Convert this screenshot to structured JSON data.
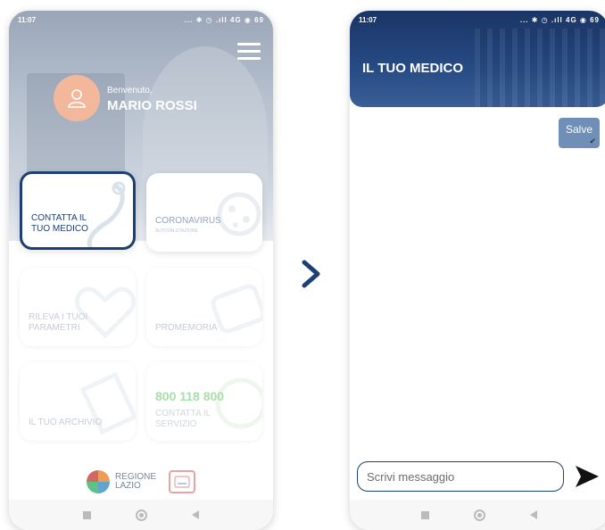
{
  "screen1": {
    "status": {
      "time": "11:07",
      "icons": "... ✱ ◷ .ıll 4G ◉ 69"
    },
    "welcome": "Benvenuto,",
    "username": "MARIO ROSSI",
    "tiles": {
      "contact_doctor": "CONTATTA IL\nTUO MEDICO",
      "coronavirus": "CORONAVIRUS",
      "coronavirus_sub": "AUTOVALUTAZIONE",
      "parameters": "RILEVA I TUOI\nPARAMETRI",
      "reminders": "PROMEMORIA",
      "archive": "IL TUO ARCHIVIO",
      "phone_number": "800 118 800",
      "contact_service": "CONTATTA IL\nSERVIZIO"
    },
    "logos": {
      "regione": "REGIONE",
      "lazio": "LAZIO"
    }
  },
  "screen2": {
    "status": {
      "time": "11:07",
      "icons": "... ✱ ◷ .ıll 4G ◉ 69"
    },
    "title": "IL TUO MEDICO",
    "messages": [
      {
        "text": "Salve",
        "tick": "✔"
      }
    ],
    "composer": {
      "placeholder": "Scrivi messaggio"
    }
  },
  "colors": {
    "brand_navy": "#1e3f74",
    "bubble": "#6f8eb8",
    "avatar": "#f3b89c",
    "phone_green": "#a8dea8"
  }
}
